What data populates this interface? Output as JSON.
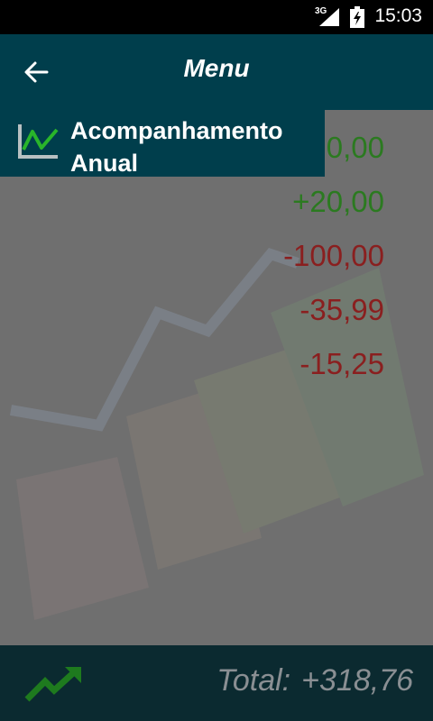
{
  "status_bar": {
    "network": "3G",
    "time": "15:03"
  },
  "app_bar": {
    "title": "Menu"
  },
  "menu": {
    "items": [
      {
        "label": "Acompanhamento Anual",
        "icon": "line-chart-icon"
      }
    ]
  },
  "values": [
    {
      "text": "0,00",
      "type": "positive"
    },
    {
      "text": "+20,00",
      "type": "positive"
    },
    {
      "text": "-100,00",
      "type": "negative"
    },
    {
      "text": "-35,99",
      "type": "negative"
    },
    {
      "text": "-15,25",
      "type": "negative"
    }
  ],
  "footer": {
    "total_label": "Total:",
    "total_value": "+318,76"
  },
  "colors": {
    "primary": "#003e4c",
    "positive": "#2b7a20",
    "negative": "#8a1f1f",
    "accent_green": "#29b52a"
  }
}
